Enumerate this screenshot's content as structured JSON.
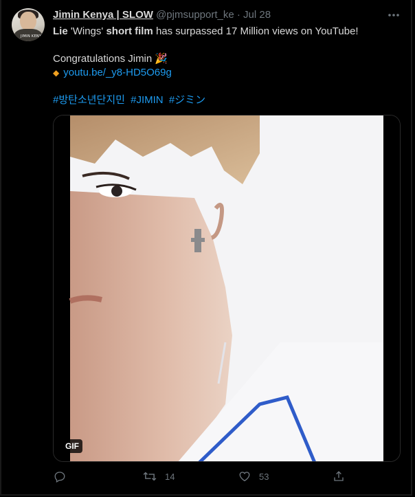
{
  "tweet": {
    "display_name": "Jimin Kenya | SLOW",
    "handle": "@pjmsupport_ke",
    "separator": "·",
    "date": "Jul 28",
    "avatar_text": "JIMIN KENYA",
    "line1": {
      "bold1": "Lie",
      "text1": " 'Wings' ",
      "bold2": "short film",
      "text2": " has surpassed 17 Million views on YouTube!"
    },
    "line2": "Congratulations Jimin 🎉",
    "link": "youtu.be/_y8-HD5O69g",
    "hashtags": [
      "#방탄소년단지민",
      "#JIMIN",
      "#ジミン"
    ],
    "media": {
      "badge": "GIF"
    },
    "actions": {
      "reply_icon": "reply-icon",
      "retweet_count": "14",
      "like_count": "53",
      "share_icon": "share-icon"
    }
  }
}
